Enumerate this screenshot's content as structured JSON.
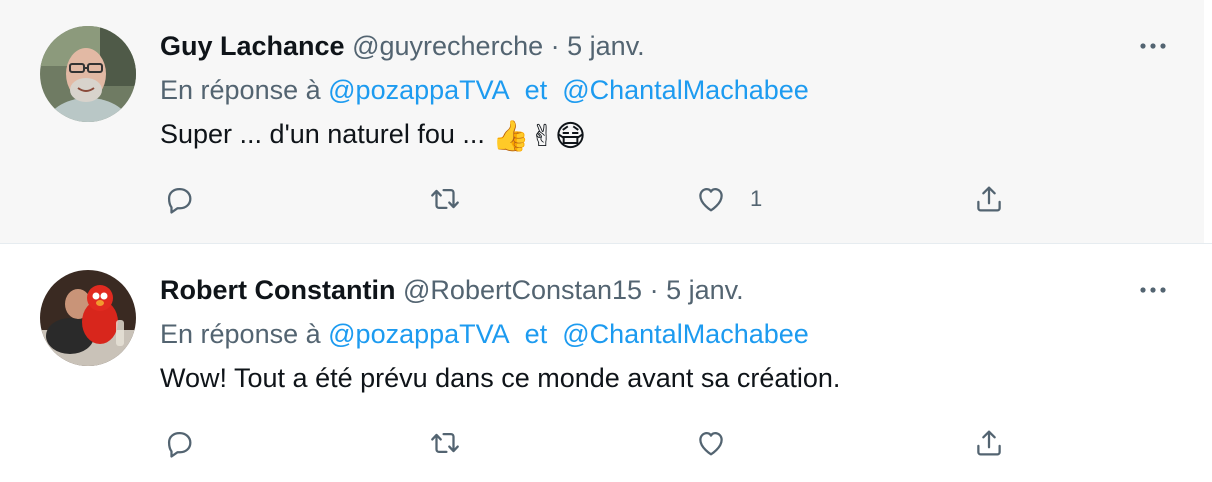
{
  "tweets": [
    {
      "name": "Guy Lachance",
      "handle": "@guyrecherche",
      "separator": "·",
      "date": "5 janv.",
      "reply_prefix": "En réponse à",
      "mention_1": "@pozappaTVA",
      "mention_joiner": "et",
      "mention_2": "@ChantalMachabee",
      "text": "Super ... d'un naturel fou ...",
      "emojis": "👍✌😷",
      "like_count": "1"
    },
    {
      "name": "Robert Constantin",
      "handle": "@RobertConstan15",
      "separator": "·",
      "date": "5 janv.",
      "reply_prefix": "En réponse à",
      "mention_1": "@pozappaTVA",
      "mention_joiner": "et",
      "mention_2": "@ChantalMachabee",
      "text": "Wow! Tout a été prévu dans ce monde avant sa création.",
      "emojis": "",
      "like_count": ""
    }
  ],
  "icons": {
    "more": "more-horizontal-icon",
    "reply": "reply-bubble-icon",
    "retweet": "retweet-icon",
    "like": "heart-icon",
    "share": "share-icon"
  },
  "colors": {
    "name": "#0f1419",
    "secondary": "#536471",
    "mention": "#1d9bf0",
    "hover_background": "#f7f7f7"
  }
}
